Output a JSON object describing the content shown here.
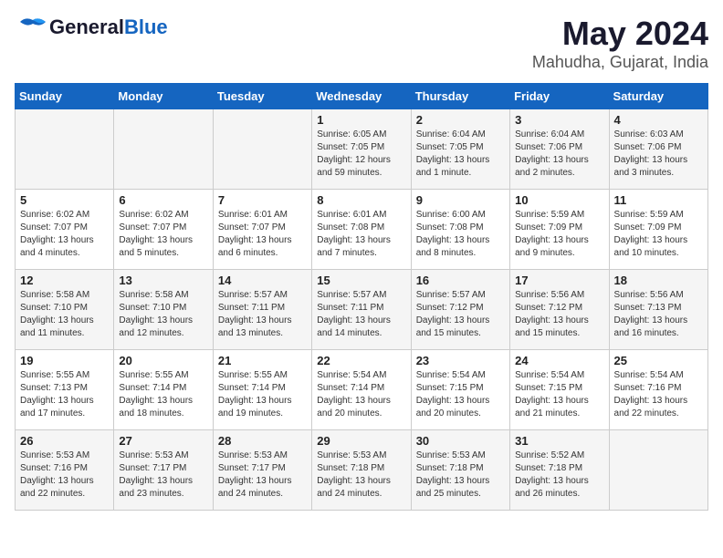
{
  "logo": {
    "general": "General",
    "blue": "Blue"
  },
  "title": "May 2024",
  "subtitle": "Mahudha, Gujarat, India",
  "days": [
    "Sunday",
    "Monday",
    "Tuesday",
    "Wednesday",
    "Thursday",
    "Friday",
    "Saturday"
  ],
  "weeks": [
    [
      {
        "day": "",
        "info": ""
      },
      {
        "day": "",
        "info": ""
      },
      {
        "day": "",
        "info": ""
      },
      {
        "day": "1",
        "info": "Sunrise: 6:05 AM\nSunset: 7:05 PM\nDaylight: 12 hours\nand 59 minutes."
      },
      {
        "day": "2",
        "info": "Sunrise: 6:04 AM\nSunset: 7:05 PM\nDaylight: 13 hours\nand 1 minute."
      },
      {
        "day": "3",
        "info": "Sunrise: 6:04 AM\nSunset: 7:06 PM\nDaylight: 13 hours\nand 2 minutes."
      },
      {
        "day": "4",
        "info": "Sunrise: 6:03 AM\nSunset: 7:06 PM\nDaylight: 13 hours\nand 3 minutes."
      }
    ],
    [
      {
        "day": "5",
        "info": "Sunrise: 6:02 AM\nSunset: 7:07 PM\nDaylight: 13 hours\nand 4 minutes."
      },
      {
        "day": "6",
        "info": "Sunrise: 6:02 AM\nSunset: 7:07 PM\nDaylight: 13 hours\nand 5 minutes."
      },
      {
        "day": "7",
        "info": "Sunrise: 6:01 AM\nSunset: 7:07 PM\nDaylight: 13 hours\nand 6 minutes."
      },
      {
        "day": "8",
        "info": "Sunrise: 6:01 AM\nSunset: 7:08 PM\nDaylight: 13 hours\nand 7 minutes."
      },
      {
        "day": "9",
        "info": "Sunrise: 6:00 AM\nSunset: 7:08 PM\nDaylight: 13 hours\nand 8 minutes."
      },
      {
        "day": "10",
        "info": "Sunrise: 5:59 AM\nSunset: 7:09 PM\nDaylight: 13 hours\nand 9 minutes."
      },
      {
        "day": "11",
        "info": "Sunrise: 5:59 AM\nSunset: 7:09 PM\nDaylight: 13 hours\nand 10 minutes."
      }
    ],
    [
      {
        "day": "12",
        "info": "Sunrise: 5:58 AM\nSunset: 7:10 PM\nDaylight: 13 hours\nand 11 minutes."
      },
      {
        "day": "13",
        "info": "Sunrise: 5:58 AM\nSunset: 7:10 PM\nDaylight: 13 hours\nand 12 minutes."
      },
      {
        "day": "14",
        "info": "Sunrise: 5:57 AM\nSunset: 7:11 PM\nDaylight: 13 hours\nand 13 minutes."
      },
      {
        "day": "15",
        "info": "Sunrise: 5:57 AM\nSunset: 7:11 PM\nDaylight: 13 hours\nand 14 minutes."
      },
      {
        "day": "16",
        "info": "Sunrise: 5:57 AM\nSunset: 7:12 PM\nDaylight: 13 hours\nand 15 minutes."
      },
      {
        "day": "17",
        "info": "Sunrise: 5:56 AM\nSunset: 7:12 PM\nDaylight: 13 hours\nand 15 minutes."
      },
      {
        "day": "18",
        "info": "Sunrise: 5:56 AM\nSunset: 7:13 PM\nDaylight: 13 hours\nand 16 minutes."
      }
    ],
    [
      {
        "day": "19",
        "info": "Sunrise: 5:55 AM\nSunset: 7:13 PM\nDaylight: 13 hours\nand 17 minutes."
      },
      {
        "day": "20",
        "info": "Sunrise: 5:55 AM\nSunset: 7:14 PM\nDaylight: 13 hours\nand 18 minutes."
      },
      {
        "day": "21",
        "info": "Sunrise: 5:55 AM\nSunset: 7:14 PM\nDaylight: 13 hours\nand 19 minutes."
      },
      {
        "day": "22",
        "info": "Sunrise: 5:54 AM\nSunset: 7:14 PM\nDaylight: 13 hours\nand 20 minutes."
      },
      {
        "day": "23",
        "info": "Sunrise: 5:54 AM\nSunset: 7:15 PM\nDaylight: 13 hours\nand 20 minutes."
      },
      {
        "day": "24",
        "info": "Sunrise: 5:54 AM\nSunset: 7:15 PM\nDaylight: 13 hours\nand 21 minutes."
      },
      {
        "day": "25",
        "info": "Sunrise: 5:54 AM\nSunset: 7:16 PM\nDaylight: 13 hours\nand 22 minutes."
      }
    ],
    [
      {
        "day": "26",
        "info": "Sunrise: 5:53 AM\nSunset: 7:16 PM\nDaylight: 13 hours\nand 22 minutes."
      },
      {
        "day": "27",
        "info": "Sunrise: 5:53 AM\nSunset: 7:17 PM\nDaylight: 13 hours\nand 23 minutes."
      },
      {
        "day": "28",
        "info": "Sunrise: 5:53 AM\nSunset: 7:17 PM\nDaylight: 13 hours\nand 24 minutes."
      },
      {
        "day": "29",
        "info": "Sunrise: 5:53 AM\nSunset: 7:18 PM\nDaylight: 13 hours\nand 24 minutes."
      },
      {
        "day": "30",
        "info": "Sunrise: 5:53 AM\nSunset: 7:18 PM\nDaylight: 13 hours\nand 25 minutes."
      },
      {
        "day": "31",
        "info": "Sunrise: 5:52 AM\nSunset: 7:18 PM\nDaylight: 13 hours\nand 26 minutes."
      },
      {
        "day": "",
        "info": ""
      }
    ]
  ]
}
